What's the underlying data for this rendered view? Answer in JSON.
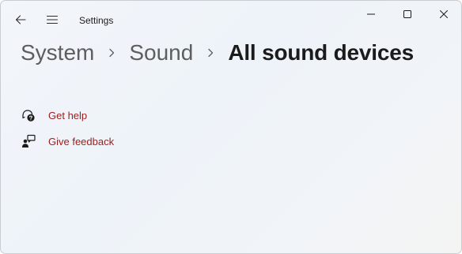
{
  "window": {
    "app_title": "Settings",
    "icons": {
      "back": "back-arrow-icon",
      "menu": "hamburger-menu-icon",
      "minimize": "minimize-icon",
      "maximize": "maximize-icon",
      "close": "close-icon"
    }
  },
  "breadcrumb": {
    "items": [
      "System",
      "Sound",
      "All sound devices"
    ],
    "separator_icon": "chevron-right-icon"
  },
  "help": {
    "get_help_label": "Get help",
    "give_feedback_label": "Give feedback",
    "get_help_icon": "help-chat-icon",
    "give_feedback_icon": "feedback-person-icon"
  },
  "colors": {
    "accent_link": "#9b1c1c",
    "breadcrumb_inactive": "#5e5e5e",
    "breadcrumb_active": "#1b1b1b"
  }
}
